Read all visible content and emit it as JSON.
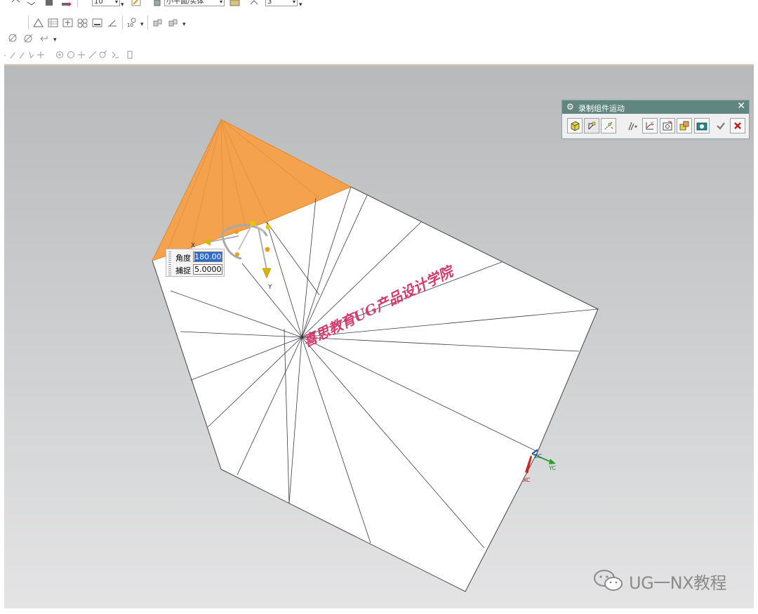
{
  "toolbar": {
    "combo_values": [
      "10",
      "小平面/实体",
      "3"
    ]
  },
  "angle_input": {
    "angle_label": "角度",
    "angle_value": "180.000",
    "snap_label": "捕捉",
    "snap_value": "5.00000"
  },
  "dialog": {
    "title": "录制组件运动",
    "buttons": [
      "move-object",
      "move-handle",
      "snap-handle",
      "collision-check",
      "rotate-wcs",
      "make-camera",
      "reset",
      "take-snapshot",
      "ok",
      "cancel"
    ]
  },
  "scene": {
    "watermark_text": "喜思教育UG产品设计学院",
    "handle_labels": {
      "x": "X",
      "y": "Y"
    },
    "triad_labels": {
      "zc": "ZC",
      "yc": "YC",
      "xc": "XC"
    },
    "colors": {
      "face": "#f5a24e",
      "sheet": "#ffffff",
      "accent": "#d63a6a"
    }
  },
  "branding": {
    "text": "UG一NX教程",
    "icon": "wechat-icon"
  }
}
